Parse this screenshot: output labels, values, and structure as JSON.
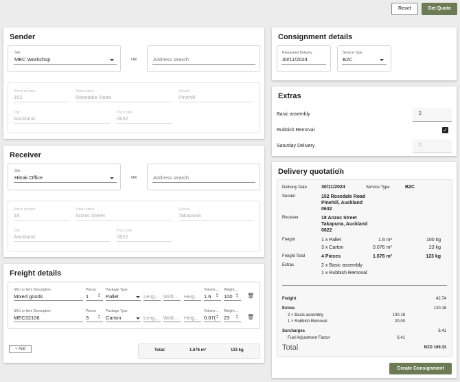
{
  "top_actions": {
    "reset": "Reset",
    "quote": "Get Quote"
  },
  "sender": {
    "title": "Sender",
    "site_label": "Site",
    "site_value": "MEC Workshop",
    "or": "OR",
    "address_placeholder": "Address search",
    "street_number_label": "Street number",
    "street_number": "152",
    "street_name_label": "Street name",
    "street_name": "Rosedale Road",
    "suburb_label": "Suburb",
    "suburb": "Pinehill",
    "city_label": "City",
    "city": "Auckland",
    "postcode_label": "Post code",
    "postcode": "0632"
  },
  "receiver": {
    "title": "Receiver",
    "site_label": "Site",
    "site_value": "Hitrak Office",
    "or": "OR",
    "address_placeholder": "Address search",
    "street_number_label": "Street number",
    "street_number": "18",
    "street_name_label": "Street name",
    "street_name": "Anzac Street",
    "suburb_label": "Suburb",
    "suburb": "Takapuna",
    "city_label": "City",
    "city": "Auckland",
    "postcode_label": "Post code",
    "postcode": "0622"
  },
  "freight": {
    "title": "Freight details",
    "col_sku": "SKU or Item Description",
    "col_pieces": "Pieces",
    "col_package": "Package Type",
    "col_volume": "Volume,...",
    "col_weight": "Weight,...",
    "ph_length": "Leng...",
    "ph_width": "Widt...",
    "ph_height": "Heig...",
    "rows": [
      {
        "sku": "Mixed goods",
        "pieces": "1",
        "package": "Pallet",
        "volume": "1.6",
        "weight": "100"
      },
      {
        "sku": "MEC32106",
        "pieces": "3",
        "package": "Carton",
        "volume": "0.07(",
        "weight": "23"
      }
    ],
    "add_label": "+ Add",
    "total_label": "Total:",
    "total_volume": "1.676 m³",
    "total_weight": "123 kg"
  },
  "consignment": {
    "title": "Consignment details",
    "date_label": "Requested Delivery",
    "date_value": "30/11/2024",
    "service_label": "Service Type",
    "service_value": "B2C"
  },
  "extras": {
    "title": "Extras",
    "basic_label": "Basic assembly",
    "basic_value": "2",
    "rubbish_label": "Rubbish Removal",
    "saturday_label": "Saturday Delivery",
    "saturday_value": "0"
  },
  "quotation": {
    "title": "Delivery quotation",
    "delivery_date_label": "Delivery Date",
    "delivery_date": "30/11/2024",
    "service_type_label": "Service Type",
    "service_type": "B2C",
    "sender_label": "Sender",
    "sender_lines": [
      "152 Rosedale Road",
      "Pinehill, Auckland",
      "0632"
    ],
    "receiver_label": "Receiver",
    "receiver_lines": [
      "18 Anzac Street",
      "Takapuna, Auckland",
      "0622"
    ],
    "freight_label": "Freight",
    "freight_items": [
      {
        "desc": "1 x Pallet",
        "vol": "1.6 m³",
        "wt": "100 kg"
      },
      {
        "desc": "3 x Carton",
        "vol": "0.076 m³",
        "wt": "23 kg"
      }
    ],
    "freight_total_label": "Freight Total",
    "freight_total_pieces": "4 Pieces",
    "freight_total_vol": "1.676 m³",
    "freight_total_wt": "123 kg",
    "extras_label": "Extras",
    "extras_lines": [
      "2 x Basic assembly",
      "1 x Rubbish Removal"
    ],
    "cost_freight_label": "Freight",
    "cost_freight": "42.74",
    "cost_extras_label": "Extras",
    "cost_extras": "120.18",
    "cost_extra_items": [
      {
        "desc": "2 × Basic assembly",
        "amt": "100.18"
      },
      {
        "desc": "1 × Rubbish Removal",
        "amt": "20.00"
      }
    ],
    "surcharges_label": "Surcharges",
    "surcharges": "6.41",
    "fuel_label": "Fuel Adjustment Factor",
    "fuel": "6.41",
    "total_label": "Total",
    "total": "NZD 169.33",
    "create_button": "Create Consignment"
  }
}
